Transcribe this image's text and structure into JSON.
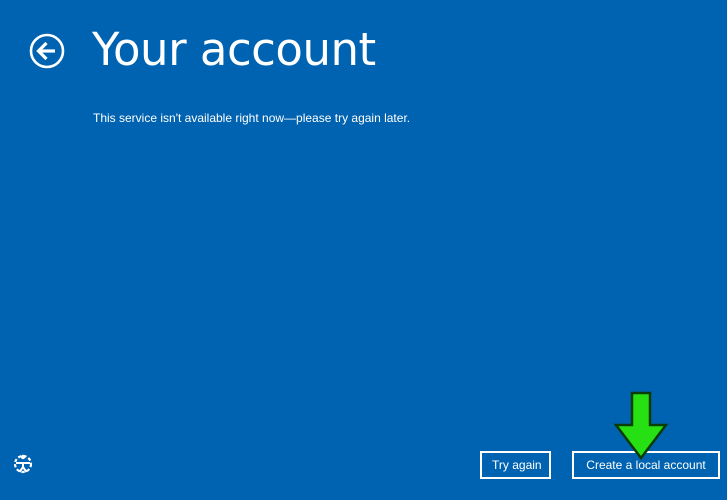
{
  "page": {
    "title": "Your account",
    "message": "This service isn't available right now—please try again later."
  },
  "icons": {
    "back": "back-arrow-icon",
    "ease_of_access": "ease-of-access-icon",
    "annotation_arrow": "green-down-arrow-icon"
  },
  "buttons": {
    "try_again": "Try again",
    "create_local_account": "Create a local account"
  },
  "colors": {
    "background": "#0063b1",
    "text": "#ffffff",
    "annotation_arrow": "#27e014"
  }
}
